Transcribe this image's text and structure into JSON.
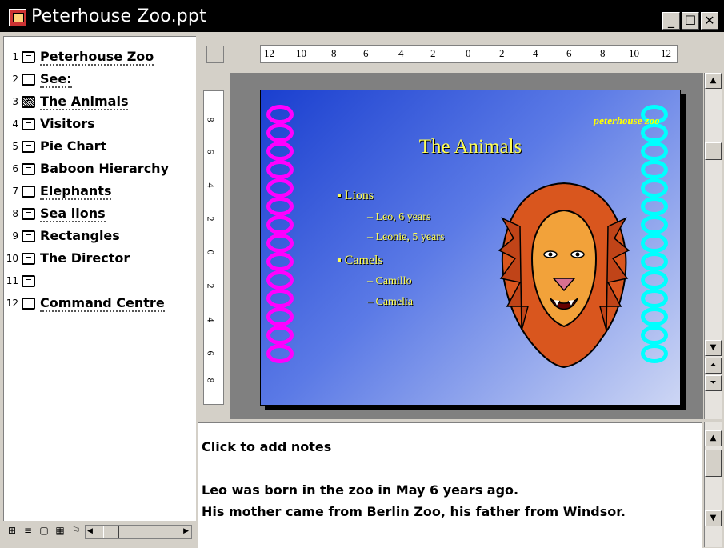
{
  "window": {
    "title": "Peterhouse Zoo.ppt",
    "controls": {
      "minimize": "_",
      "restore": "☐",
      "close": "✕"
    }
  },
  "outline": {
    "items": [
      {
        "num": "1",
        "label": "Peterhouse Zoo"
      },
      {
        "num": "2",
        "label": "See:"
      },
      {
        "num": "3",
        "label": "The Animals"
      },
      {
        "num": "4",
        "label": "Visitors"
      },
      {
        "num": "5",
        "label": "Pie Chart"
      },
      {
        "num": "6",
        "label": "Baboon Hierarchy"
      },
      {
        "num": "7",
        "label": "Elephants"
      },
      {
        "num": "8",
        "label": "Sea lions"
      },
      {
        "num": "9",
        "label": "Rectangles"
      },
      {
        "num": "10",
        "label": "The Director"
      },
      {
        "num": "11",
        "label": ""
      },
      {
        "num": "12",
        "label": "Command Centre"
      }
    ],
    "selected_index": 2
  },
  "ruler": {
    "horizontal": [
      "12",
      "10",
      "8",
      "6",
      "4",
      "2",
      "0",
      "2",
      "4",
      "6",
      "8",
      "10",
      "12"
    ],
    "vertical": [
      "8",
      "6",
      "4",
      "2",
      "0",
      "2",
      "4",
      "6",
      "8"
    ]
  },
  "slide": {
    "title": "The Animals",
    "logo": "peterhouse zoo",
    "bullets": [
      {
        "text": "Lions",
        "subs": [
          "– Leo, 6 years",
          "– Leonie, 5 years"
        ]
      },
      {
        "text": "Camels",
        "subs": [
          "– Camillo",
          "– Camelia"
        ]
      }
    ],
    "colors": {
      "left_rings": "#ff00ff",
      "right_rings": "#00ffff",
      "text": "#ffff55",
      "bg_start": "#1a3fcf",
      "bg_end": "#cdd6f4"
    }
  },
  "notes": {
    "placeholder": "Click to add notes",
    "line1": "Leo was born in the zoo in May 6 years ago.",
    "line2": "His mother came from Berlin Zoo, his father from Windsor."
  },
  "icons": {
    "arrow_up": "▲",
    "arrow_down": "▼",
    "arrow_left": "◀",
    "arrow_right": "▶",
    "prev_slide": "⏶",
    "next_slide": "⏷",
    "view_normal": "⊞",
    "view_outline": "≡",
    "view_slide": "▢",
    "view_sorter": "▦",
    "view_show": "⚐"
  }
}
